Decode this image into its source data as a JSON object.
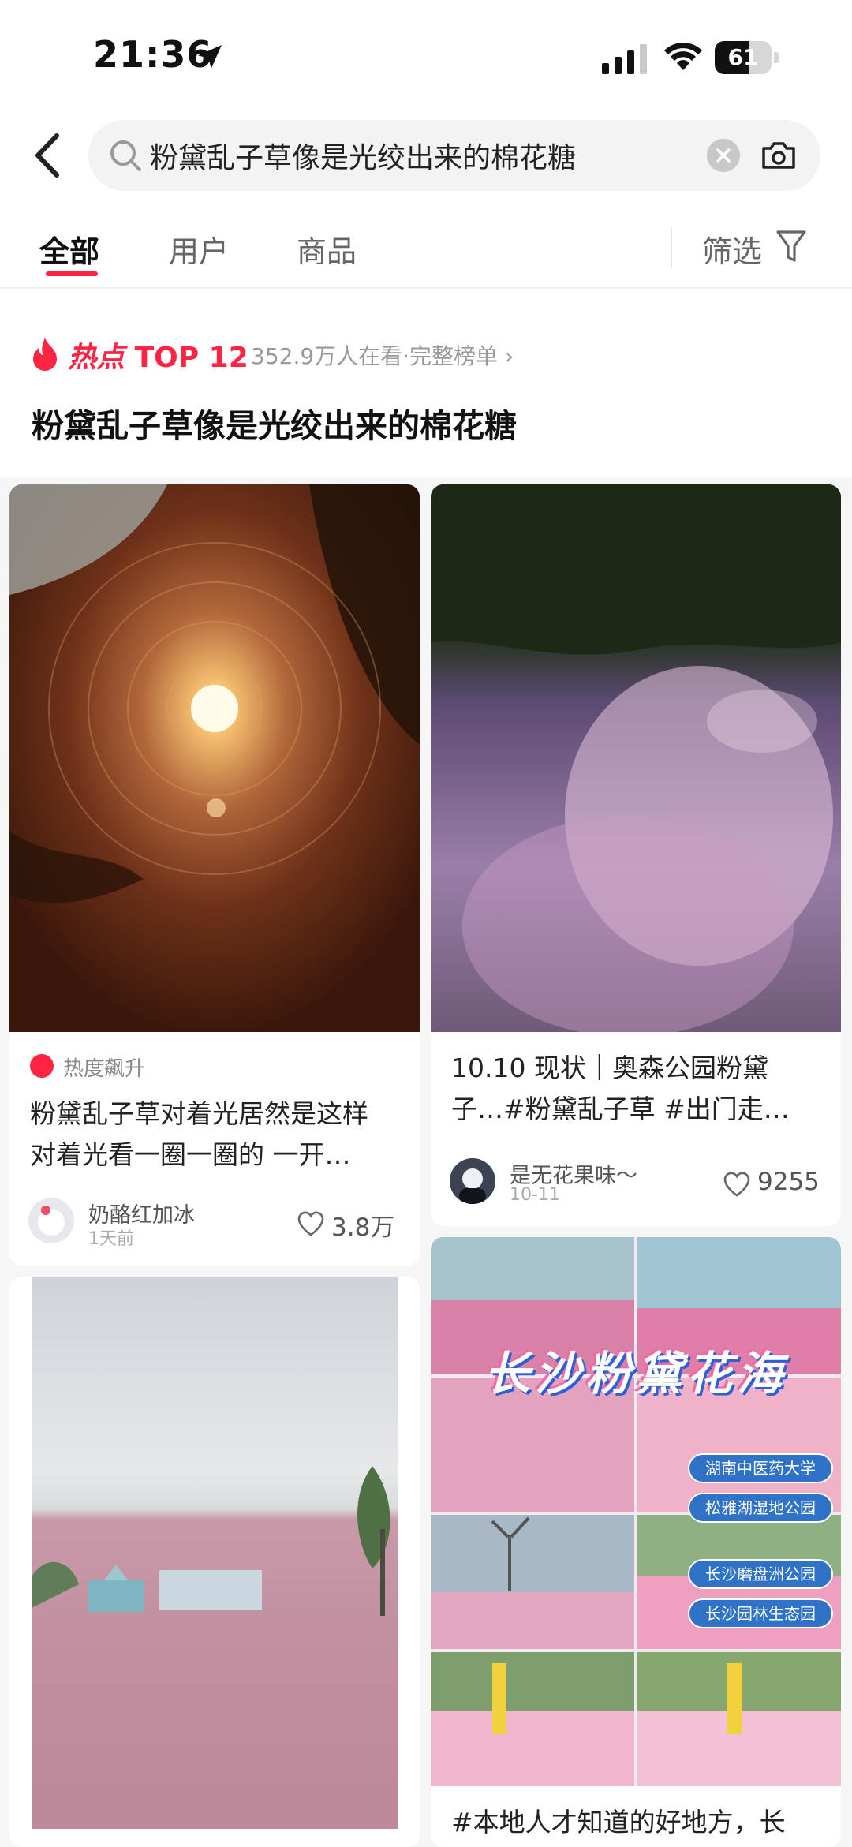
{
  "status_bar": {
    "time": "21:36",
    "battery_percent": 61,
    "battery_label": "61"
  },
  "search": {
    "query": "粉黛乱子草像是光绞出来的棉花糖"
  },
  "tabs": [
    {
      "label": "全部",
      "active": true
    },
    {
      "label": "用户",
      "active": false
    },
    {
      "label": "商品",
      "active": false
    }
  ],
  "filter_label": "筛选",
  "hot_topic": {
    "label": "热点",
    "rank": "TOP 12",
    "viewers": "352.9万人在看·完整榜单 ›",
    "title": "粉黛乱子草像是光绞出来的棉花糖"
  },
  "cards": [
    {
      "badge": "热度飙升",
      "title_line1": "粉黛乱子草对着光居然是这样",
      "title_line2": "对着光看一圈一圈的 一开…",
      "author": "奶酪红加冰",
      "date": "1天前",
      "likes": "3.8万"
    },
    {
      "title_line1": "10.10 现状｜奥森公园粉黛",
      "title_line2": "子…#粉黛乱子草 #出门走…",
      "author": "是无花果味～",
      "date": "10-11",
      "likes": "9255"
    },
    {
      "image_title": "长沙粉黛花海",
      "image_tags": [
        "湖南中医药大学",
        "松雅湖湿地公园",
        "长沙磨盘洲公园",
        "长沙园林生态园"
      ],
      "title_line1": "#本地人才知道的好地方，长"
    }
  ],
  "colors": {
    "accent": "#ff2442",
    "text": "#222222",
    "muted": "#999999"
  }
}
